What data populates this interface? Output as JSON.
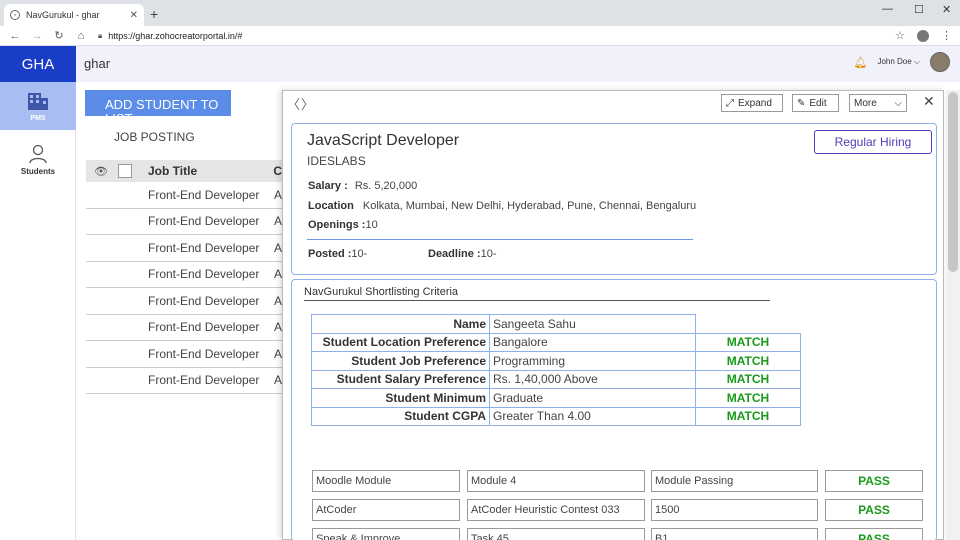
{
  "browser": {
    "tab_title": "NavGurukul - ghar",
    "new_tab": "+",
    "url": "https://ghar.zohocreatorportal.in/#",
    "win_min": "—",
    "win_max": "☐",
    "win_close": "✕",
    "tab_close": "✕"
  },
  "header": {
    "logo": "GHA",
    "app_title": "ghar",
    "user_name": "John Doe ⌵"
  },
  "nav": {
    "pms_label": "PMS",
    "students_label": "Students"
  },
  "list": {
    "add_button": "ADD STUDENT TO LIST",
    "job_posting": "JOB POSTING",
    "col_title": "Job Title",
    "col_2": "C",
    "rows": [
      {
        "title": "Front-End Developer",
        "c": "A"
      },
      {
        "title": "Front-End Developer",
        "c": "A"
      },
      {
        "title": "Front-End Developer",
        "c": "A"
      },
      {
        "title": "Front-End Developer",
        "c": "A"
      },
      {
        "title": "Front-End Developer",
        "c": "A"
      },
      {
        "title": "Front-End Developer",
        "c": "A"
      },
      {
        "title": "Front-End Developer",
        "c": "A"
      },
      {
        "title": "Front-End Developer",
        "c": "A"
      }
    ]
  },
  "modal": {
    "prev": "〈",
    "next": "〉",
    "expand_label": "Expand",
    "edit_label": "Edit",
    "more_label": "More",
    "job": {
      "title": "JavaScript Developer",
      "company": "IDESLABS",
      "hiring_type": "Regular Hiring",
      "salary_label": "Salary :",
      "salary_value": "Rs. 5,20,000",
      "location_label": "Location",
      "location_value": "Kolkata, Mumbai, New Delhi, Hyderabad, Pune, Chennai, Bengaluru",
      "openings_label": "Openings :",
      "openings_value": "10",
      "posted_label": "Posted :",
      "posted_value": "10-",
      "deadline_label": "Deadline :",
      "deadline_value": "10-"
    },
    "criteria": {
      "title": "NavGurukul Shortlisting Criteria",
      "rows": [
        {
          "key": "Name",
          "value": "Sangeeta Sahu",
          "match": ""
        },
        {
          "key": "Student Location Preference",
          "value": "Bangalore",
          "match": "MATCH"
        },
        {
          "key": "Student Job Preference",
          "value": "Programming",
          "match": "MATCH"
        },
        {
          "key": "Student Salary Preference",
          "value": "Rs. 1,40,000 Above",
          "match": "MATCH"
        },
        {
          "key": "Student Minimum",
          "value": "Graduate",
          "match": "MATCH"
        },
        {
          "key": "Student CGPA",
          "value": "Greater Than 4.00",
          "match": "MATCH"
        }
      ]
    },
    "modules": [
      {
        "a": "Moodle Module",
        "b": "Module 4",
        "c": "Module Passing",
        "result": "PASS"
      },
      {
        "a": "AtCoder",
        "b": "AtCoder Heuristic Contest 033",
        "c": "1500",
        "result": "PASS"
      },
      {
        "a": "Speak & Improve",
        "b": "Task 45",
        "c": "B1",
        "result": "PASS"
      }
    ]
  }
}
